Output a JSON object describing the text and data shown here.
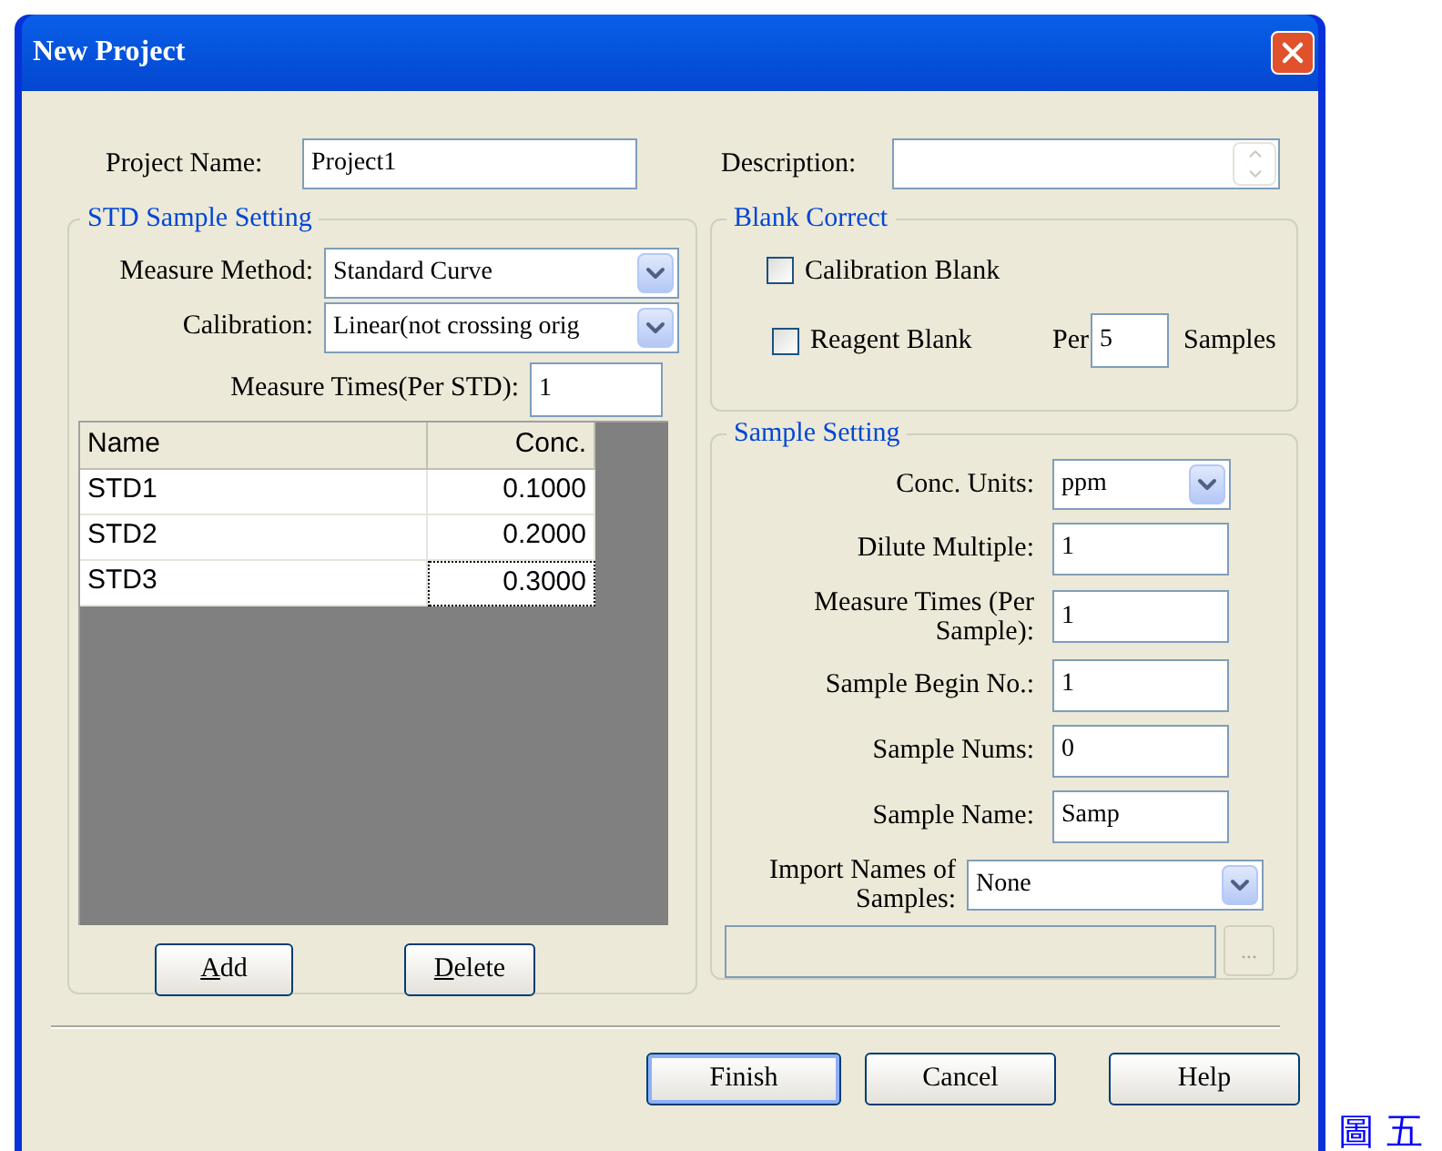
{
  "window": {
    "title": "New Project"
  },
  "project_name": {
    "label": "Project Name:",
    "value": "Project1"
  },
  "description": {
    "label": "Description:"
  },
  "std_sample_setting": {
    "title": "STD Sample Setting",
    "measure_method": {
      "label": "Measure Method:",
      "value": "Standard Curve"
    },
    "calibration": {
      "label": "Calibration:",
      "value": "Linear(not crossing orig"
    },
    "measure_times": {
      "label": "Measure Times(Per STD):",
      "value": "1"
    },
    "table": {
      "columns": [
        "Name",
        "Conc."
      ],
      "rows": [
        {
          "cells": [
            "STD1",
            "0.1000"
          ],
          "focused": false
        },
        {
          "cells": [
            "STD2",
            "0.2000"
          ],
          "focused": false
        },
        {
          "cells": [
            "STD3",
            "0.3000"
          ],
          "focused": true
        }
      ]
    },
    "buttons": [
      {
        "underlined": "A",
        "rest": "dd"
      },
      {
        "underlined": "D",
        "rest": "elete"
      }
    ]
  },
  "blank_correct": {
    "title": "Blank Correct",
    "calibration_blank": {
      "label": "Calibration Blank",
      "checked": false
    },
    "reagent_blank": {
      "label": "Reagent Blank",
      "checked": false
    },
    "per_label": "Per",
    "per_value": "5",
    "samples_label": "Samples"
  },
  "sample_setting": {
    "title": "Sample Setting",
    "fields": [
      {
        "kind": "select",
        "label": "Conc. Units:",
        "value": "ppm"
      },
      {
        "kind": "input",
        "label": "Dilute Multiple:",
        "value": "1"
      },
      {
        "kind": "input",
        "label": "Measure Times (Per Sample):",
        "value": "1"
      },
      {
        "kind": "input",
        "label": "Sample Begin No.:",
        "value": "1"
      },
      {
        "kind": "input",
        "label": "Sample Nums:",
        "value": "0"
      },
      {
        "kind": "input",
        "label": "Sample Name:",
        "value": "Samp"
      },
      {
        "kind": "wide_select",
        "label": "Import Names of Samples:",
        "value": "None"
      }
    ],
    "file_path": {
      "disabled": true
    },
    "browse_button": {
      "label": "...",
      "disabled": true
    }
  },
  "footer_buttons": [
    {
      "label": "Finish",
      "default": true
    },
    {
      "label": "Cancel",
      "default": false
    },
    {
      "label": "Help",
      "default": false
    }
  ],
  "caption": "圖 五"
}
